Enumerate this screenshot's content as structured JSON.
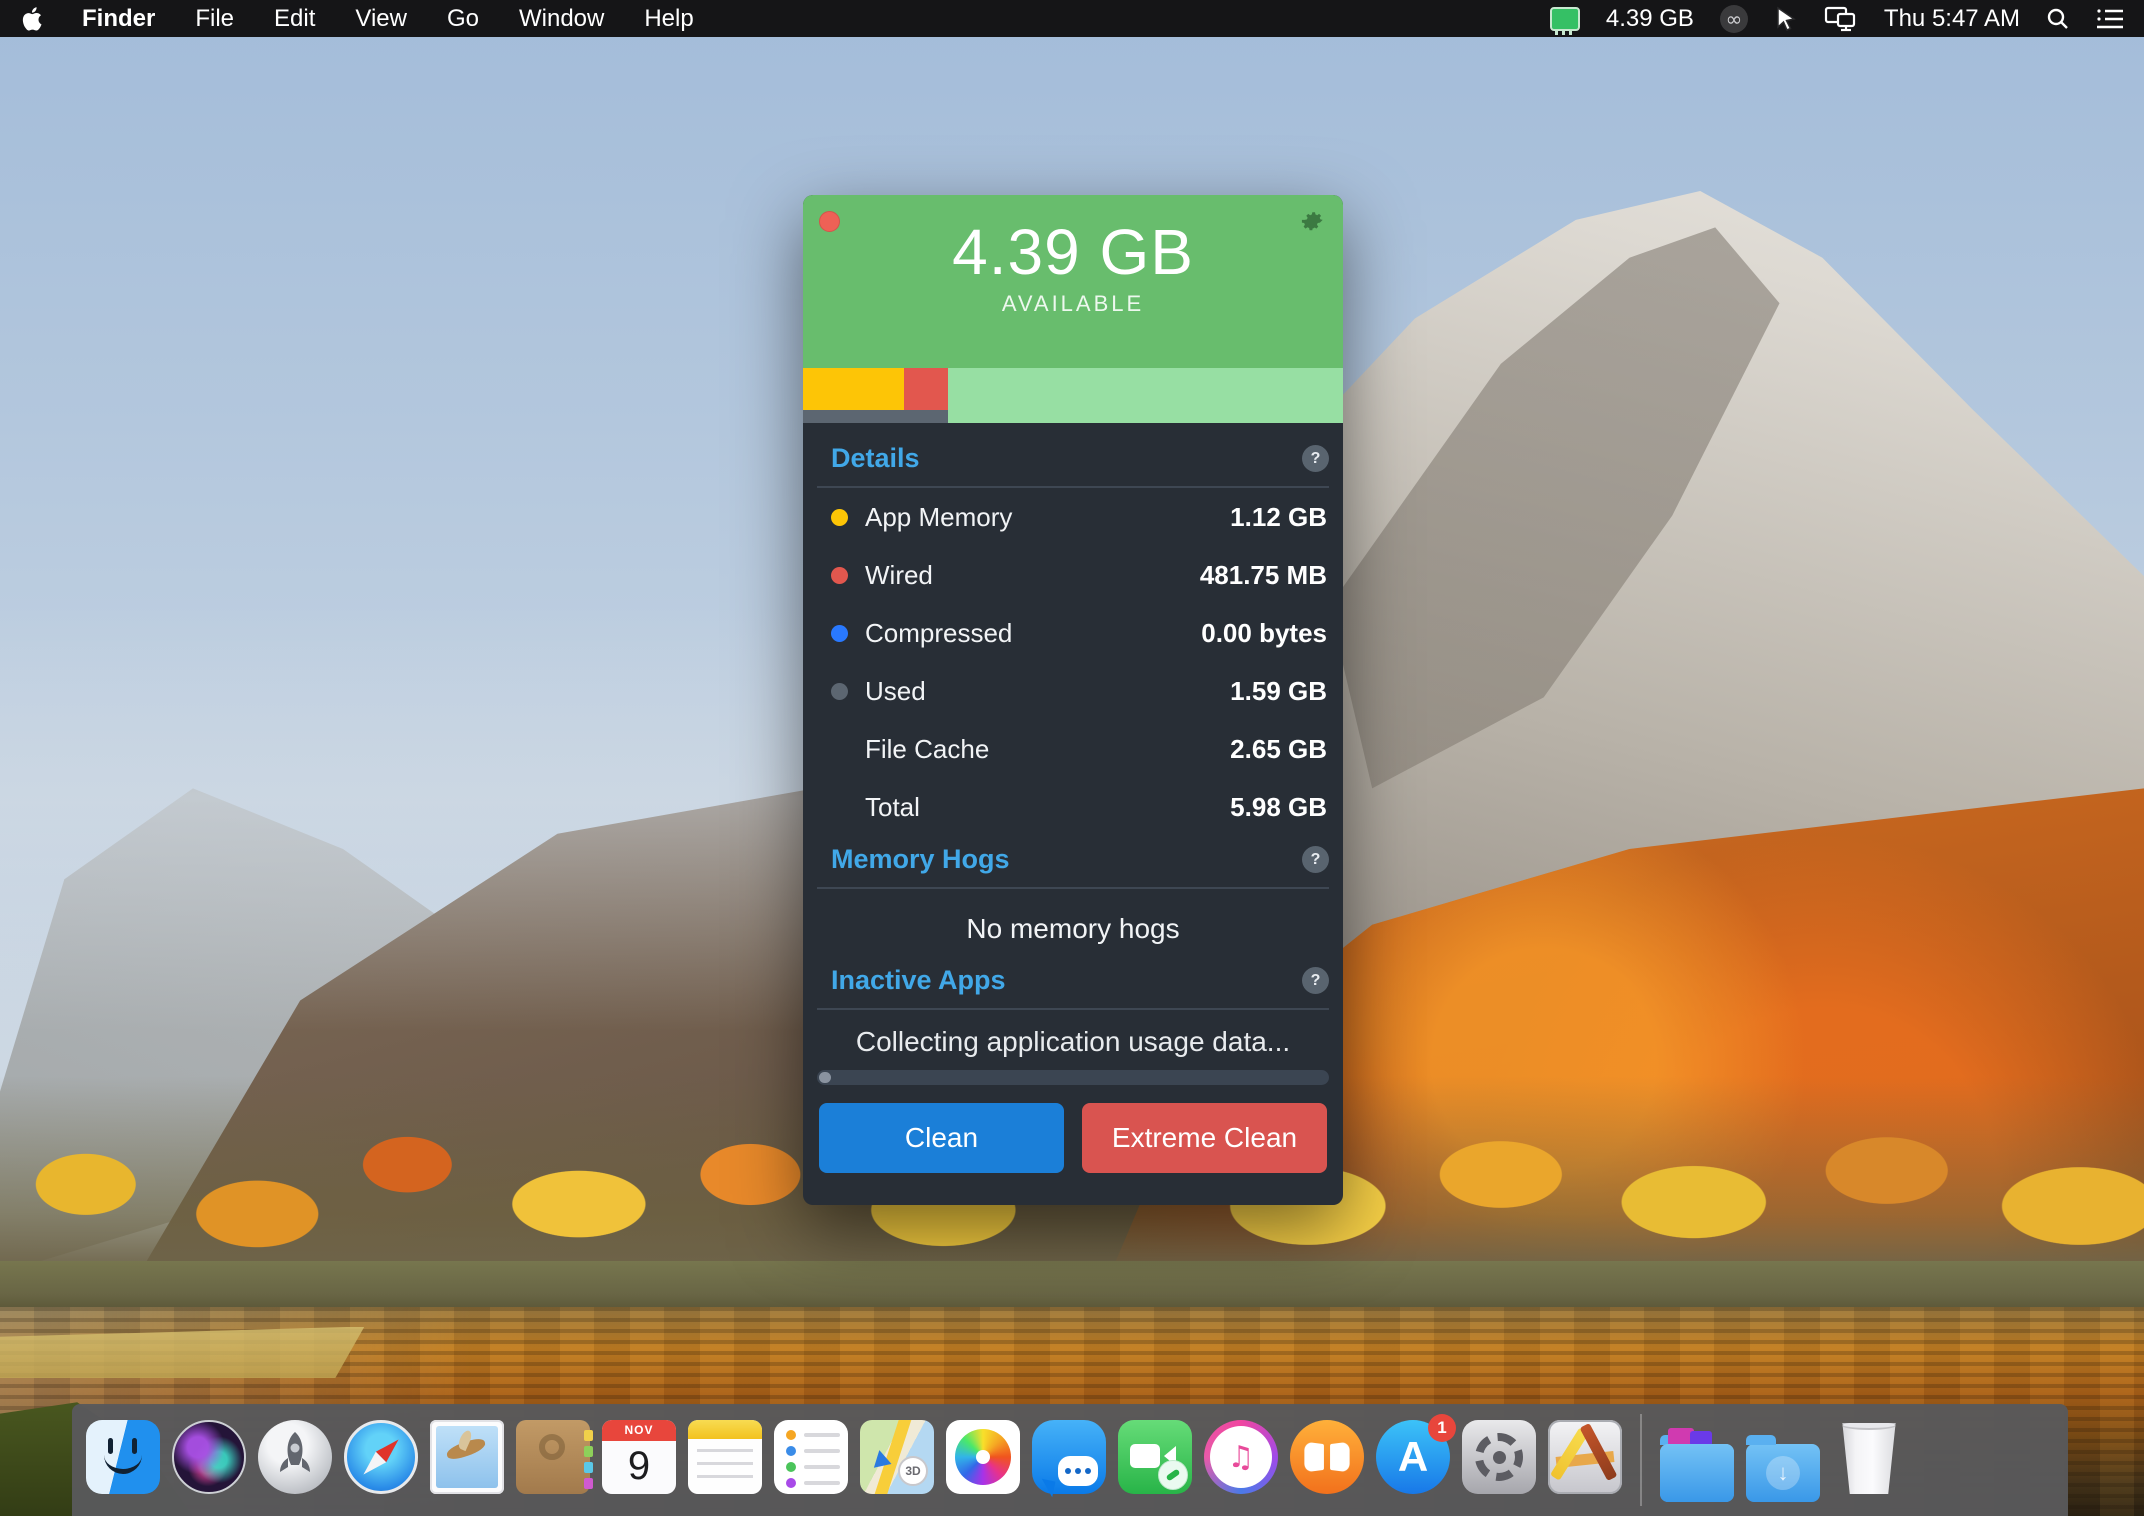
{
  "menu_bar": {
    "active_app": "Finder",
    "menus": [
      "File",
      "Edit",
      "View",
      "Go",
      "Window",
      "Help"
    ],
    "status_memory": "4.39 GB",
    "clock": "Thu 5:47 AM"
  },
  "app_window": {
    "available_value": "4.39 GB",
    "available_label": "AVAILABLE",
    "memory_bar": {
      "segments": [
        {
          "name": "App Memory",
          "color": "#fdc506",
          "percent": 18.7
        },
        {
          "name": "Wired",
          "color": "#e2574e",
          "percent": 8.1
        },
        {
          "name": "Free",
          "color": "#97dfa3",
          "percent": 73.2
        }
      ],
      "used_percent": 26.8,
      "used_color": "#5c6671"
    },
    "details": {
      "title": "Details",
      "help": "?",
      "rows": [
        {
          "label": "App Memory",
          "value": "1.12 GB",
          "dot_color": "#fdc506"
        },
        {
          "label": "Wired",
          "value": "481.75 MB",
          "dot_color": "#e2574e"
        },
        {
          "label": "Compressed",
          "value": "0.00 bytes",
          "dot_color": "#2979ff"
        },
        {
          "label": "Used",
          "value": "1.59 GB",
          "dot_color": "#5c6671"
        },
        {
          "label": "File Cache",
          "value": "2.65 GB",
          "dot_color": null
        },
        {
          "label": "Total",
          "value": "5.98 GB",
          "dot_color": null
        }
      ]
    },
    "memory_hogs": {
      "title": "Memory Hogs",
      "help": "?",
      "empty_message": "No memory hogs"
    },
    "inactive_apps": {
      "title": "Inactive Apps",
      "help": "?",
      "status_message": "Collecting application usage data..."
    },
    "buttons": {
      "clean": "Clean",
      "extreme_clean": "Extreme Clean"
    }
  },
  "dock": {
    "calendar_month": "NOV",
    "calendar_day": "9",
    "maps_3d_label": "3D",
    "app_store_badge": "1"
  },
  "colors": {
    "header_green": "#68bd6d",
    "free_green": "#97dfa3",
    "accent_blue": "#41a8e8",
    "clean_button_blue": "#1b7fd8",
    "extreme_button_red": "#d95450",
    "close_button_red": "#ee6156",
    "window_bg": "#282e36"
  }
}
